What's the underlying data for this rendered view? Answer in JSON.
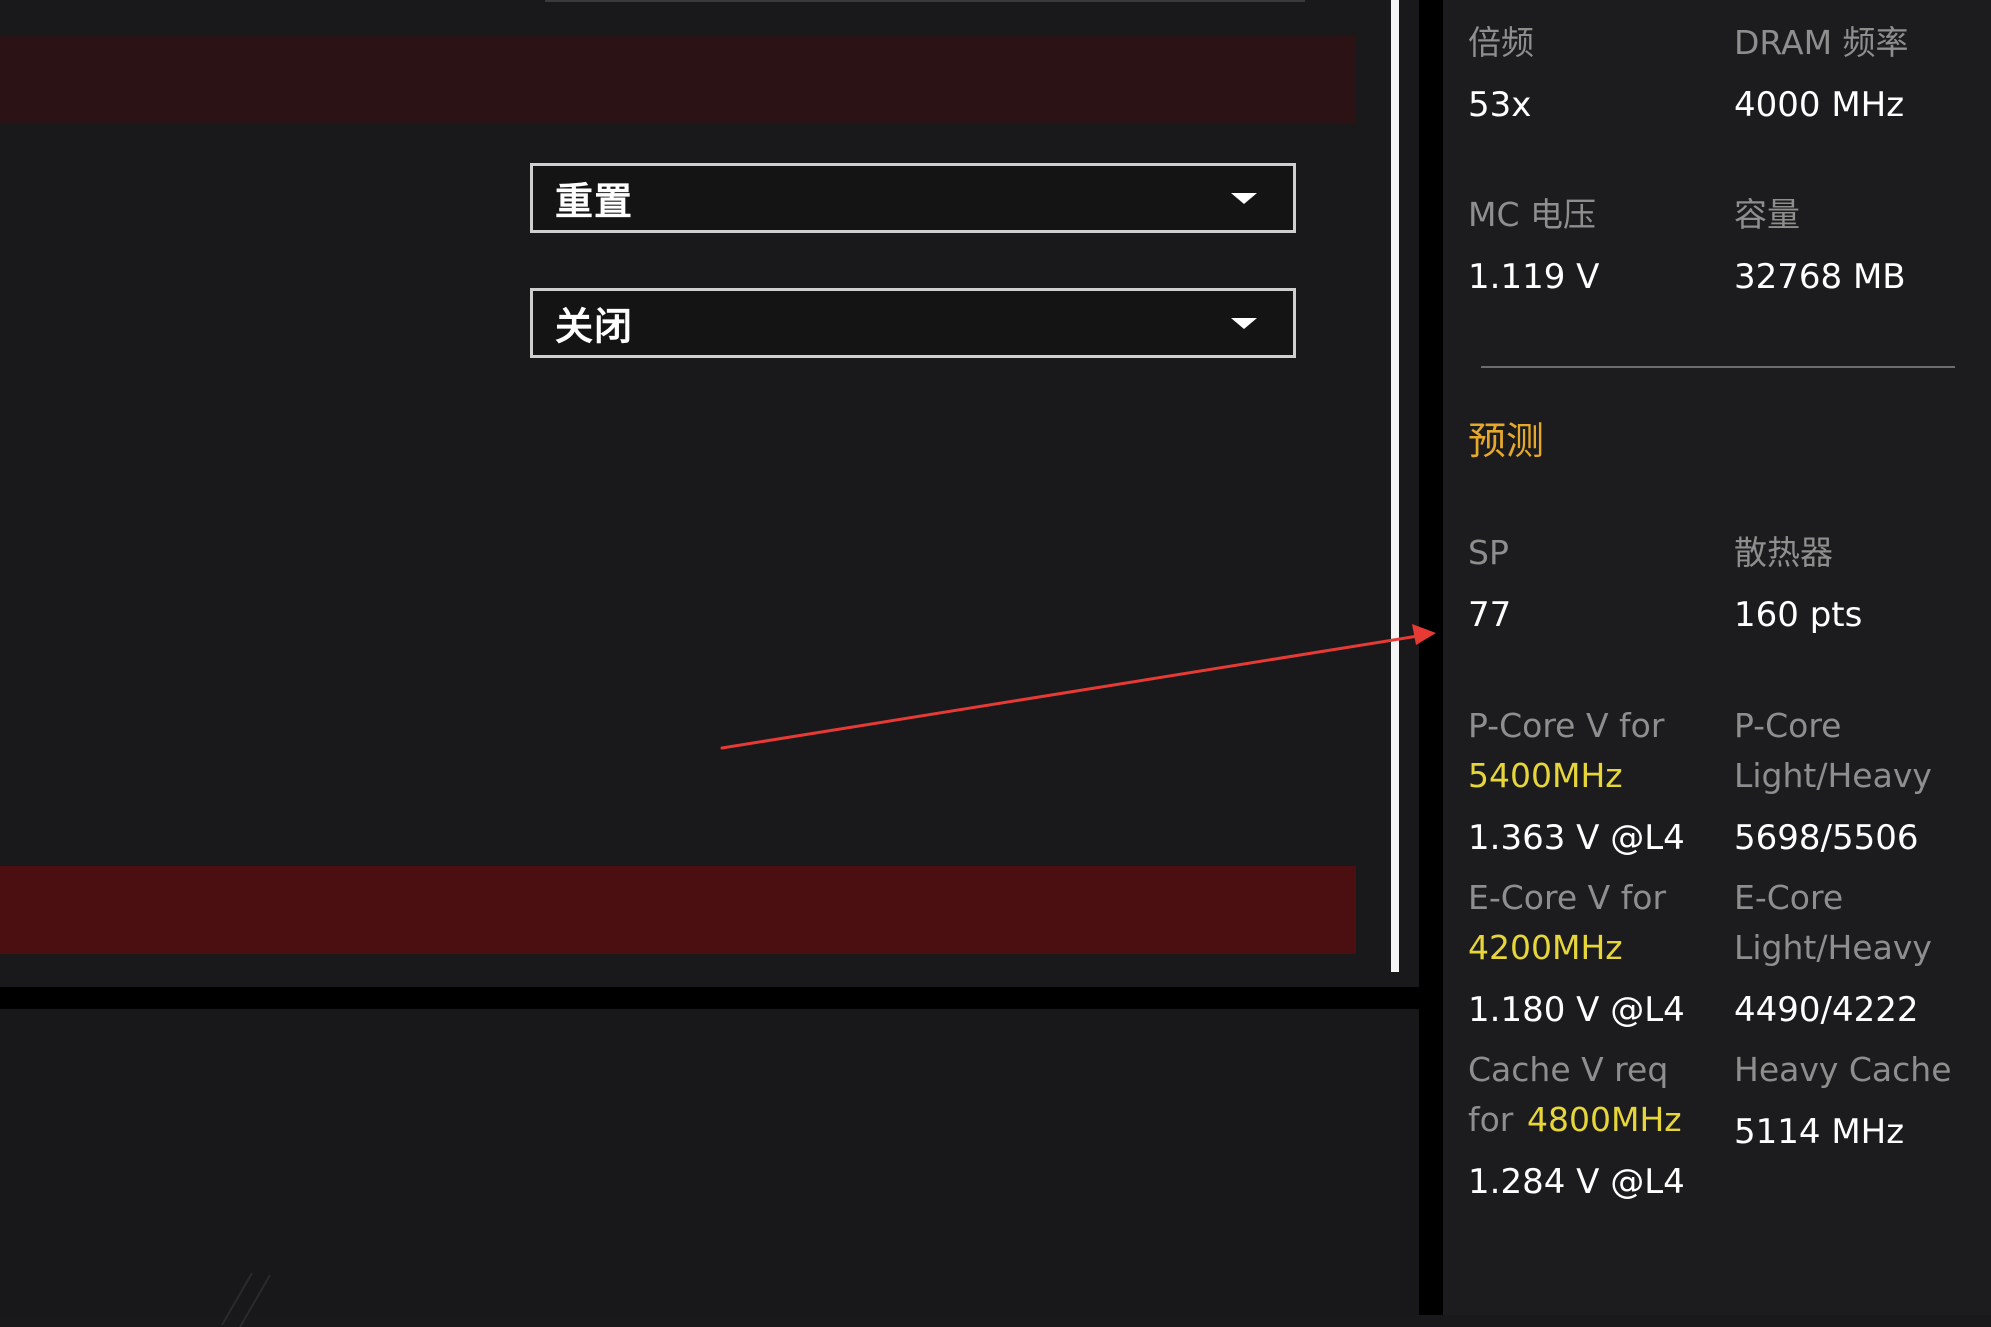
{
  "main": {
    "dropdowns": [
      {
        "value": "重置"
      },
      {
        "value": "关闭"
      }
    ]
  },
  "colors": {
    "accent_red_band": "#4b0e11",
    "section_title": "#e5a82a",
    "highlight_freq": "#e6d63a",
    "annotation_arrow": "#e83a35"
  },
  "sidebar": {
    "freq": {
      "multiplier_label": "倍频",
      "multiplier_value": "53x",
      "dram_label": "DRAM 频率",
      "dram_value": "4000 MHz"
    },
    "mem": {
      "mc_label": "MC 电压",
      "mc_value": "1.119 V",
      "cap_label": "容量",
      "cap_value": "32768 MB"
    },
    "predict_title": "预测",
    "sp": {
      "sp_label": "SP",
      "sp_value": "77",
      "cooler_label": "散热器",
      "cooler_value": "160 pts"
    },
    "pcore": {
      "v_label_prefix": "P-Core V for",
      "v_label_freq": "5400MHz",
      "v_value": "1.363 V @L4",
      "lh_label_line1": "P-Core",
      "lh_label_line2": "Light/Heavy",
      "lh_value": "5698/5506"
    },
    "ecore": {
      "v_label_prefix": "E-Core V for",
      "v_label_freq": "4200MHz",
      "v_value": "1.180 V @L4",
      "lh_label_line1": "E-Core",
      "lh_label_line2": "Light/Heavy",
      "lh_value": "4490/4222"
    },
    "cache": {
      "v_label_prefix": "Cache V req",
      "v_label_for": "for",
      "v_label_freq": "4800MHz",
      "v_value": "1.284 V @L4",
      "heavy_label": "Heavy Cache",
      "heavy_value": "5114 MHz"
    }
  }
}
